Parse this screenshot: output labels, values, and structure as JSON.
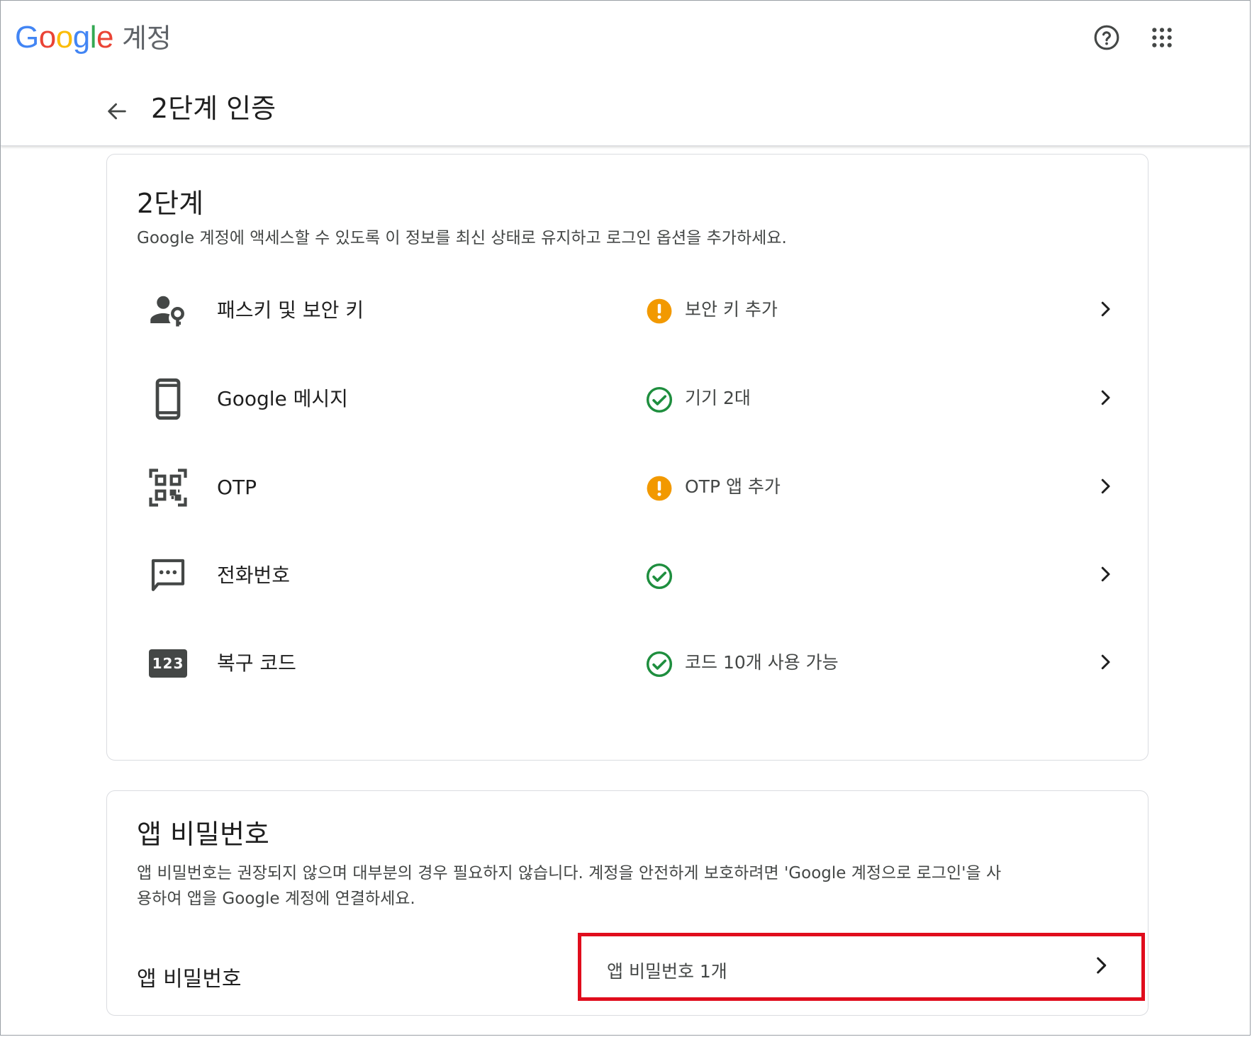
{
  "header": {
    "logo_text": "Google",
    "product": "계정",
    "help_icon": "help-circle-icon",
    "apps_icon": "apps-grid-icon",
    "back_icon": "arrow-left-icon",
    "page_title": "2단계 인증"
  },
  "two_step": {
    "title": "2단계",
    "description": "Google 계정에 액세스할 수 있도록 이 정보를 최신 상태로 유지하고 로그인 옵션을 추가하세요.",
    "methods": [
      {
        "label": "패스키 및 보안 키",
        "icon": "passkey-person-key-icon",
        "status_icon": "warning-icon",
        "status": "보안 키 추가"
      },
      {
        "label": "Google 메시지",
        "icon": "phone-icon",
        "status_icon": "check-circle-icon",
        "status": "기기 2대"
      },
      {
        "label": "OTP",
        "icon": "qr-code-icon",
        "status_icon": "warning-icon",
        "status": "OTP 앱 추가"
      },
      {
        "label": "전화번호",
        "icon": "sms-chat-icon",
        "status_icon": "check-circle-icon",
        "status": ""
      },
      {
        "label": "복구 코드",
        "icon": "backup-code-123-icon",
        "status_icon": "check-circle-icon",
        "status": "코드 10개 사용 가능"
      }
    ],
    "backup_icon_text": "123"
  },
  "app_passwords": {
    "title": "앱 비밀번호",
    "description_line1": "앱 비밀번호는 권장되지 않으며 대부분의 경우 필요하지 않습니다. 계정을 안전하게 보호하려면 'Google 계정으로 로그인'을 사",
    "description_line2": "용하여 앱을 Google 계정에 연결하세요.",
    "row_label": "앱 비밀번호",
    "row_value": "앱 비밀번호 1개"
  },
  "colors": {
    "warning": "#f29900",
    "success": "#1e8e3e",
    "highlight": "#e00d1d",
    "icon_gray": "#444746"
  }
}
